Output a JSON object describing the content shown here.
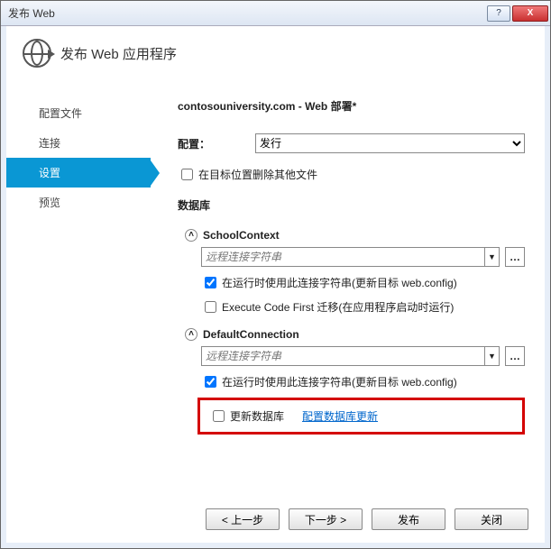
{
  "window": {
    "title": "发布 Web"
  },
  "header": {
    "title": "发布 Web 应用程序"
  },
  "sidebar": {
    "items": [
      {
        "label": "配置文件"
      },
      {
        "label": "连接"
      },
      {
        "label": "设置"
      },
      {
        "label": "预览"
      }
    ]
  },
  "content": {
    "summary": "contosouniversity.com - Web 部署*",
    "config_label": "配置：",
    "config_value": "发行",
    "delete_extra_label": "在目标位置删除其他文件",
    "db_title": "数据库",
    "school": {
      "name": "SchoolContext",
      "placeholder": "远程连接字符串",
      "use_runtime": "在运行时使用此连接字符串(更新目标 web.config)",
      "code_first": "Execute Code First 迁移(在应用程序启动时运行)"
    },
    "default": {
      "name": "DefaultConnection",
      "placeholder": "远程连接字符串",
      "use_runtime": "在运行时使用此连接字符串(更新目标 web.config)",
      "update_db": "更新数据库",
      "configure_link": "配置数据库更新"
    }
  },
  "footer": {
    "prev": "< 上一步",
    "next": "下一步 >",
    "publish": "发布",
    "close": "关闭"
  }
}
